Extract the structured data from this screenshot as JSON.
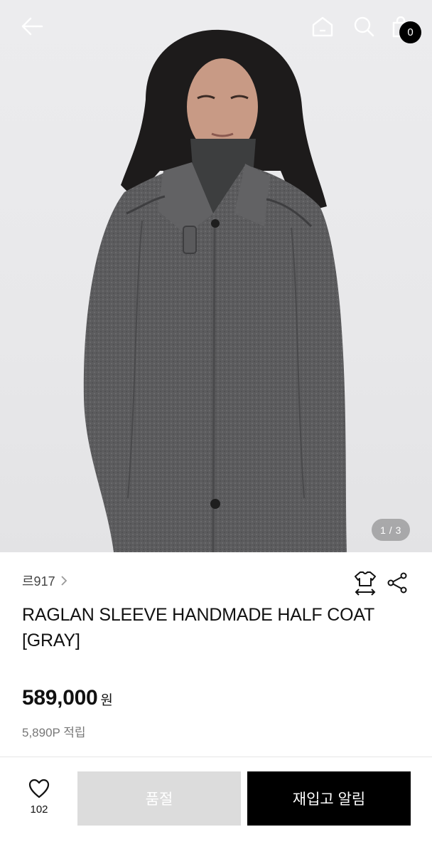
{
  "header": {
    "cart_count": "0",
    "icons": [
      "back-arrow-icon",
      "home-icon",
      "search-icon",
      "shopping-bag-icon"
    ]
  },
  "gallery": {
    "counter": "1 / 3"
  },
  "product": {
    "brand": "르917",
    "title": "RAGLAN SLEEVE HANDMADE HALF COAT [GRAY]",
    "price": "589,000",
    "currency": "원",
    "points": "5,890P 적립"
  },
  "actions": {
    "like_count": "102",
    "soldout_label": "품절",
    "restock_label": "재입고 알림"
  },
  "colors": {
    "primary_button": "#000000",
    "disabled_button": "#dcdcdc",
    "coat": "#5a5a5c"
  }
}
